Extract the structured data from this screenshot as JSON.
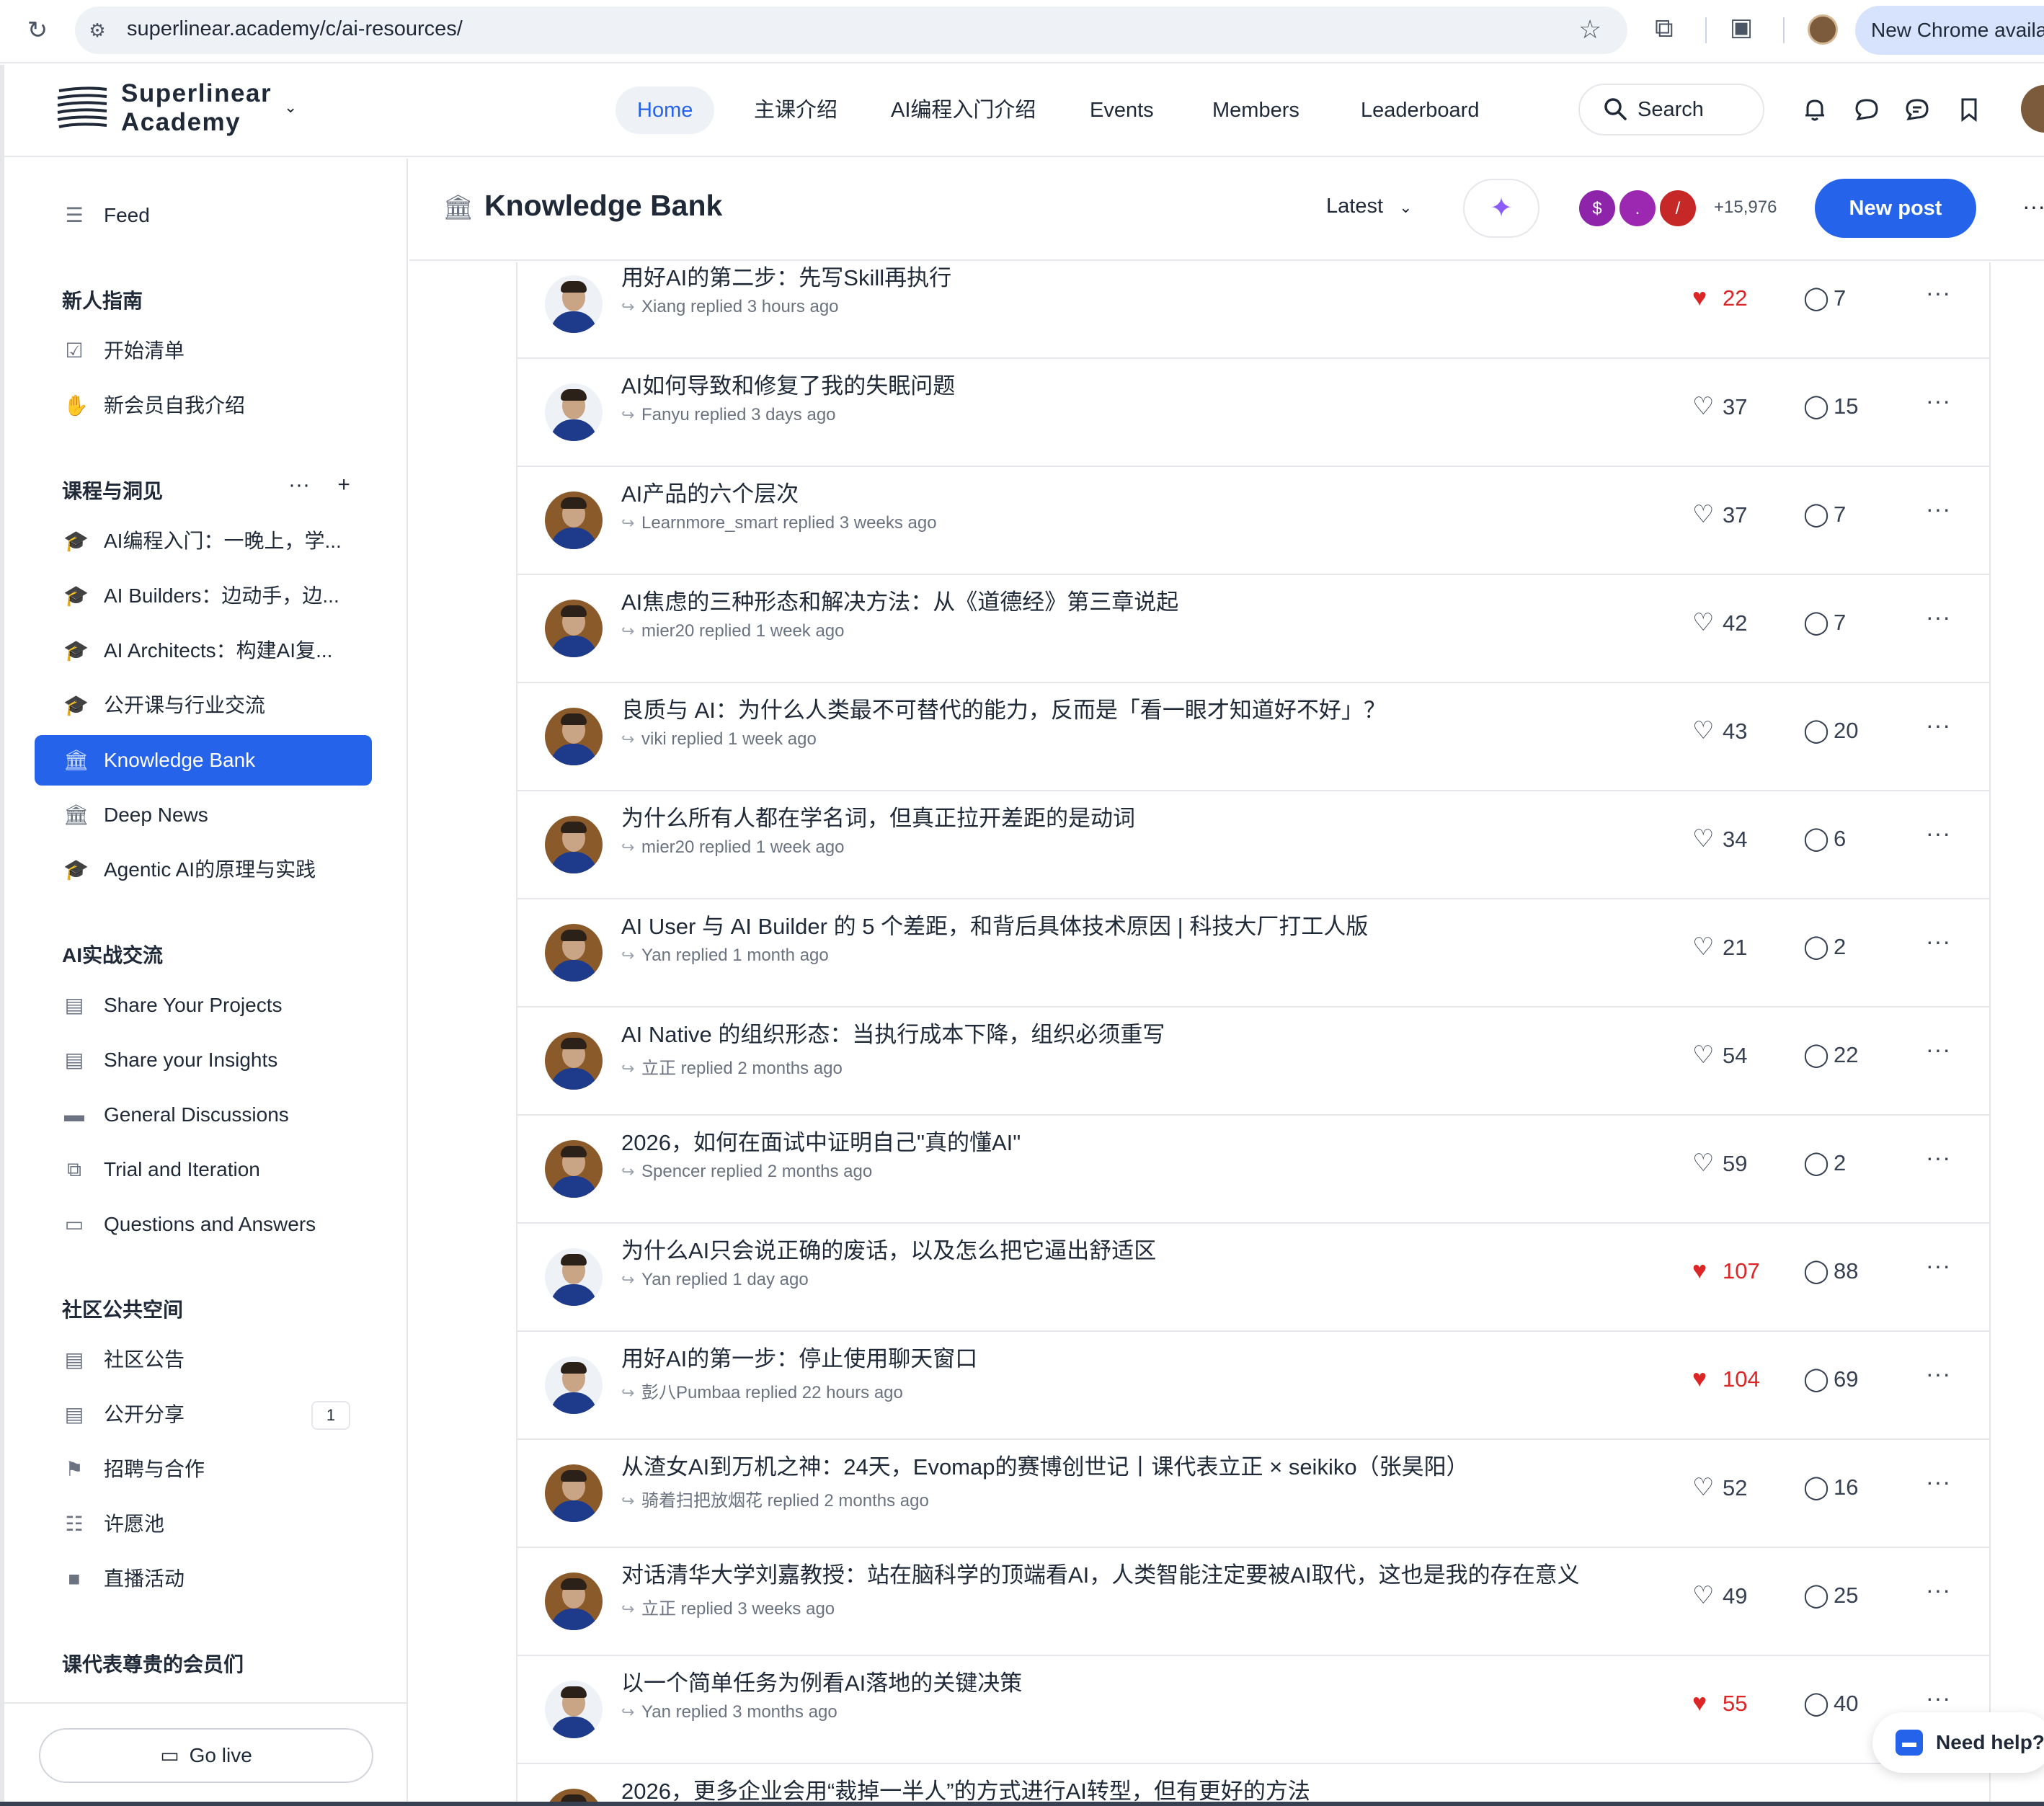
{
  "browser": {
    "url": "superlinear.academy/c/ai-resources/",
    "update_pill": "New Chrome availab"
  },
  "brand": {
    "line1": "Superlinear",
    "line2": "Academy"
  },
  "nav": {
    "items": [
      "Home",
      "主课介绍",
      "AI编程入门介绍",
      "Events",
      "Members",
      "Leaderboard"
    ],
    "search_label": "Search"
  },
  "sidebar": {
    "feed": "Feed",
    "sections": [
      {
        "title": "新人指南",
        "items": [
          {
            "label": "开始清单",
            "icon": "checkbox-icon"
          },
          {
            "label": "新会员自我介绍",
            "icon": "wave-icon"
          }
        ]
      },
      {
        "title": "课程与洞见",
        "items": [
          {
            "label": "AI编程入门：一晚上，学...",
            "icon": "graduation-cap-icon"
          },
          {
            "label": "AI Builders：边动手，边...",
            "icon": "graduation-cap-icon"
          },
          {
            "label": "AI Architects：构建AI复...",
            "icon": "graduation-cap-icon"
          },
          {
            "label": "公开课与行业交流",
            "icon": "graduation-cap-icon"
          },
          {
            "label": "Knowledge Bank",
            "icon": "bank-icon",
            "active": true
          },
          {
            "label": "Deep News",
            "icon": "bank-icon"
          },
          {
            "label": "Agentic AI的原理与实践",
            "icon": "graduation-cap-icon"
          }
        ]
      },
      {
        "title": "AI实战交流",
        "items": [
          {
            "label": "Share Your Projects",
            "icon": "store-icon"
          },
          {
            "label": "Share your Insights",
            "icon": "store-icon"
          },
          {
            "label": "General Discussions",
            "icon": "chat-icon"
          },
          {
            "label": "Trial and Iteration",
            "icon": "flow-icon"
          },
          {
            "label": "Questions and Answers",
            "icon": "qa-icon"
          }
        ]
      },
      {
        "title": "社区公共空间",
        "items": [
          {
            "label": "社区公告",
            "icon": "notice-icon"
          },
          {
            "label": "公开分享",
            "icon": "store-icon",
            "badge": "1"
          },
          {
            "label": "招聘与合作",
            "icon": "flag-icon"
          },
          {
            "label": "许愿池",
            "icon": "list-icon"
          },
          {
            "label": "直播活动",
            "icon": "video-icon"
          }
        ]
      },
      {
        "title": "课代表尊贵的会员们",
        "items": []
      }
    ],
    "go_live": "Go live"
  },
  "header": {
    "title": "Knowledge Bank",
    "sort": "Latest",
    "member_avatars": [
      {
        "letter": "$",
        "color": "#8e24aa"
      },
      {
        "letter": ".",
        "color": "#9c27b0"
      },
      {
        "letter": "/",
        "color": "#c62828"
      }
    ],
    "member_count": "+15,976",
    "new_post": "New post"
  },
  "posts": [
    {
      "title": "用好AI的第二步：先写Skill再执行",
      "meta": "Xiang replied 3 hours ago",
      "likes": "22",
      "liked": true,
      "comments": "7",
      "avatar": "plain"
    },
    {
      "title": "AI如何导致和修复了我的失眠问题",
      "meta": "Fanyu replied 3 days ago",
      "likes": "37",
      "liked": false,
      "comments": "15",
      "avatar": "plain"
    },
    {
      "title": "AI产品的六个层次",
      "meta": "Learnmore_smart replied 3 weeks ago",
      "likes": "37",
      "liked": false,
      "comments": "7",
      "avatar": "shelf"
    },
    {
      "title": "AI焦虑的三种形态和解决方法：从《道德经》第三章说起",
      "meta": "mier20 replied 1 week ago",
      "likes": "42",
      "liked": false,
      "comments": "7",
      "avatar": "shelf"
    },
    {
      "title": "良质与 AI：为什么人类最不可替代的能力，反而是「看一眼才知道好不好」？",
      "meta": "viki replied 1 week ago",
      "likes": "43",
      "liked": false,
      "comments": "20",
      "avatar": "shelf"
    },
    {
      "title": "为什么所有人都在学名词，但真正拉开差距的是动词",
      "meta": "mier20 replied 1 week ago",
      "likes": "34",
      "liked": false,
      "comments": "6",
      "avatar": "shelf"
    },
    {
      "title": "AI User 与 AI Builder 的 5 个差距，和背后具体技术原因 | 科技大厂打工人版",
      "meta": "Yan replied 1 month ago",
      "likes": "21",
      "liked": false,
      "comments": "2",
      "avatar": "shelf"
    },
    {
      "title": "AI Native 的组织形态：当执行成本下降，组织必须重写",
      "meta": "立正 replied 2 months ago",
      "likes": "54",
      "liked": false,
      "comments": "22",
      "avatar": "shelf"
    },
    {
      "title": "2026，如何在面试中证明自己\"真的懂AI\"",
      "meta": "Spencer replied 2 months ago",
      "likes": "59",
      "liked": false,
      "comments": "2",
      "avatar": "shelf"
    },
    {
      "title": "为什么AI只会说正确的废话，以及怎么把它逼出舒适区",
      "meta": "Yan replied 1 day ago",
      "likes": "107",
      "liked": true,
      "comments": "88",
      "avatar": "plain"
    },
    {
      "title": "用好AI的第一步：停止使用聊天窗口",
      "meta": "彭八Pumbaa replied 22 hours ago",
      "likes": "104",
      "liked": true,
      "comments": "69",
      "avatar": "plain"
    },
    {
      "title": "从渣女AI到万机之神：24天，Evomap的赛博创世记丨课代表立正 × seikiko（张昊阳）",
      "meta": "骑着扫把放烟花 replied 2 months ago",
      "likes": "52",
      "liked": false,
      "comments": "16",
      "avatar": "shelf"
    },
    {
      "title": "对话清华大学刘嘉教授：站在脑科学的顶端看AI，人类智能注定要被AI取代，这也是我的存在意义",
      "meta": "立正 replied 3 weeks ago",
      "likes": "49",
      "liked": false,
      "comments": "25",
      "avatar": "shelf"
    },
    {
      "title": "以一个简单任务为例看AI落地的关键决策",
      "meta": "Yan replied 3 months ago",
      "likes": "55",
      "liked": true,
      "comments": "40",
      "avatar": "plain"
    },
    {
      "title": "2026，更多企业会用“裁掉一半人”的方式进行AI转型，但有更好的方法",
      "meta": "",
      "likes": "",
      "liked": false,
      "comments": "",
      "avatar": "shelf"
    }
  ],
  "help": {
    "label": "Need help?"
  }
}
